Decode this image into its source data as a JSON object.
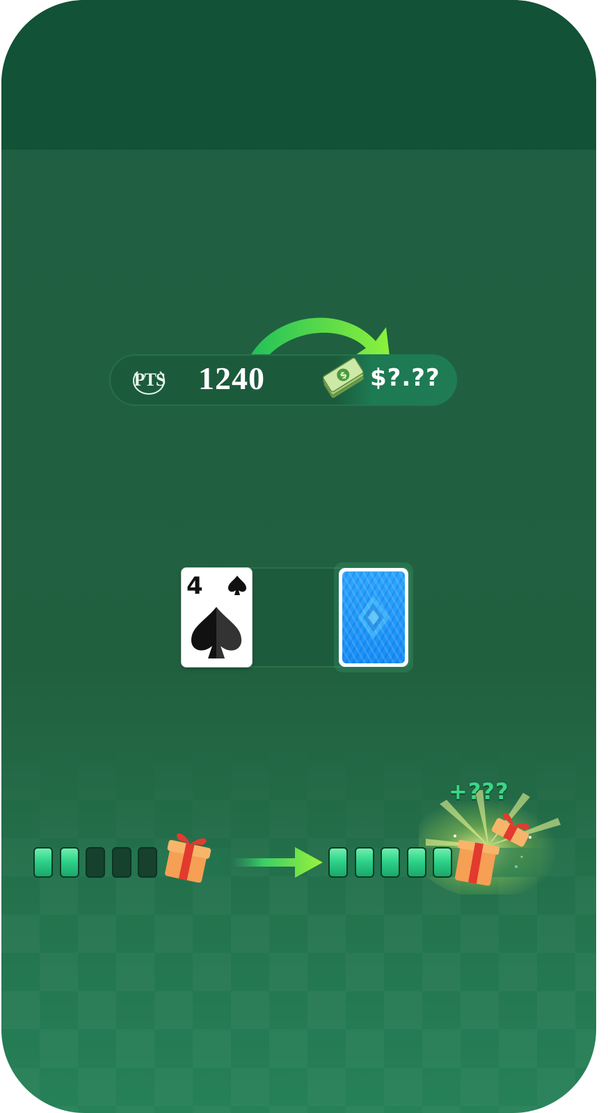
{
  "points": {
    "currency_label": "PTS",
    "value": "1240",
    "cash_icon": "dollar-bills-icon",
    "cash_value": "$?.??"
  },
  "cards": {
    "face_up": {
      "rank": "4",
      "suit": "spades"
    },
    "face_down": {
      "back_color": "#1a8ef5"
    }
  },
  "progress": {
    "before": {
      "filled": 2,
      "total": 5
    },
    "after": {
      "filled": 5,
      "total": 5
    },
    "reward_text": "+???"
  },
  "colors": {
    "felt": "#21603f",
    "top_band": "#125236",
    "accent_green": "#3ed486",
    "arrow_green": "#7ee83a"
  }
}
